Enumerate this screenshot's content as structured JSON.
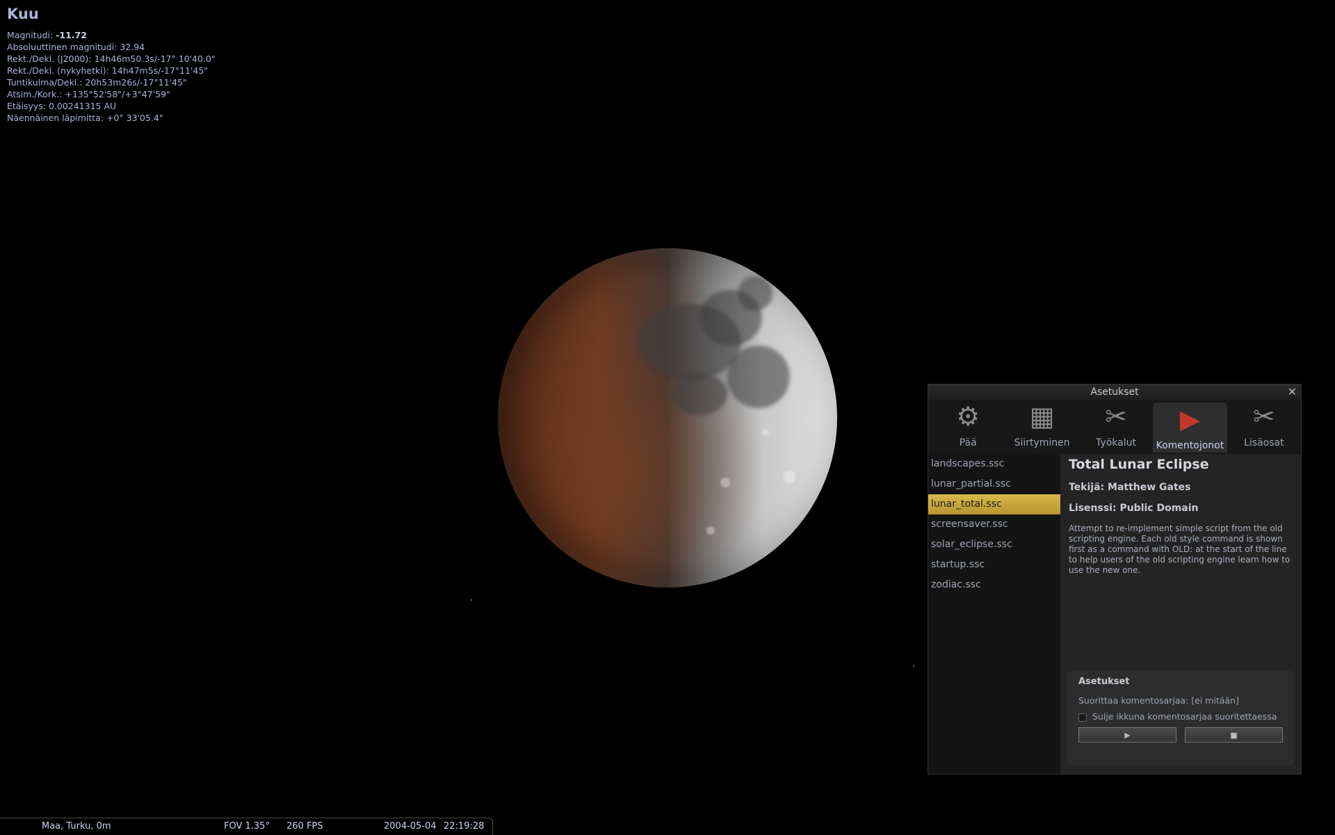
{
  "object": {
    "name": "Kuu",
    "lines": [
      {
        "label": "Magnitudi: ",
        "value": "-11.72",
        "bold": true
      },
      {
        "label": "Absoluuttinen magnitudi: ",
        "value": "32.94"
      },
      {
        "label": "Rekt./Dekl. (J2000): ",
        "value": "14h46m50.3s/-17° 10'40.0\""
      },
      {
        "label": "Rekt./Dekl. (nykyhetki): ",
        "value": "14h47m5s/-17°11'45\""
      },
      {
        "label": "Tuntikulma/Dekl.: ",
        "value": "20h53m26s/-17°11'45\""
      },
      {
        "label": "Atsim./Kork.: ",
        "value": "+135°52'58\"/+3°47'59\""
      },
      {
        "label": "Etäisyys: ",
        "value": "0.00241315 AU"
      },
      {
        "label": "Näennäinen läpimitta: ",
        "value": "+0° 33'05.4\""
      }
    ]
  },
  "window": {
    "title": "Asetukset",
    "close_icon": "close-icon",
    "tabs": [
      {
        "label": "Pää",
        "icon": "gear-icon"
      },
      {
        "label": "Siirtyminen",
        "icon": "navigation-icon"
      },
      {
        "label": "Työkalut",
        "icon": "tools-icon"
      },
      {
        "label": "Komentojonot",
        "icon": "play-icon",
        "active": true
      },
      {
        "label": "Lisäosat",
        "icon": "plugins-icon"
      }
    ],
    "scripts": [
      "landscapes.ssc",
      "lunar_partial.ssc",
      "lunar_total.ssc",
      "screensaver.ssc",
      "solar_eclipse.ssc",
      "startup.ssc",
      "zodiac.ssc"
    ],
    "selected_index": 2,
    "detail": {
      "title": "Total Lunar Eclipse",
      "author": "Tekijä: Matthew Gates",
      "license": "Lisenssi: Public Domain",
      "description": "Attempt to re-implement simple script from the old scripting engine. Each old style command is shown first as a command with OLD: at the start of the line to help users of the old scripting engine learn how to use the new one."
    },
    "options": {
      "title": "Asetukset",
      "running": "Suorittaa komentosarjaa: [ei mitään]",
      "close_checkbox": "Sulje ikkuna komentosarjaa suoritettaessa",
      "run_icon": "▶",
      "stop_icon": "■"
    }
  },
  "statusbar": {
    "location": "Maa, Turku, 0m",
    "fov": "FOV 1.35°",
    "fps": "260 FPS",
    "date": "2004-05-04",
    "time": "22:19:28"
  }
}
